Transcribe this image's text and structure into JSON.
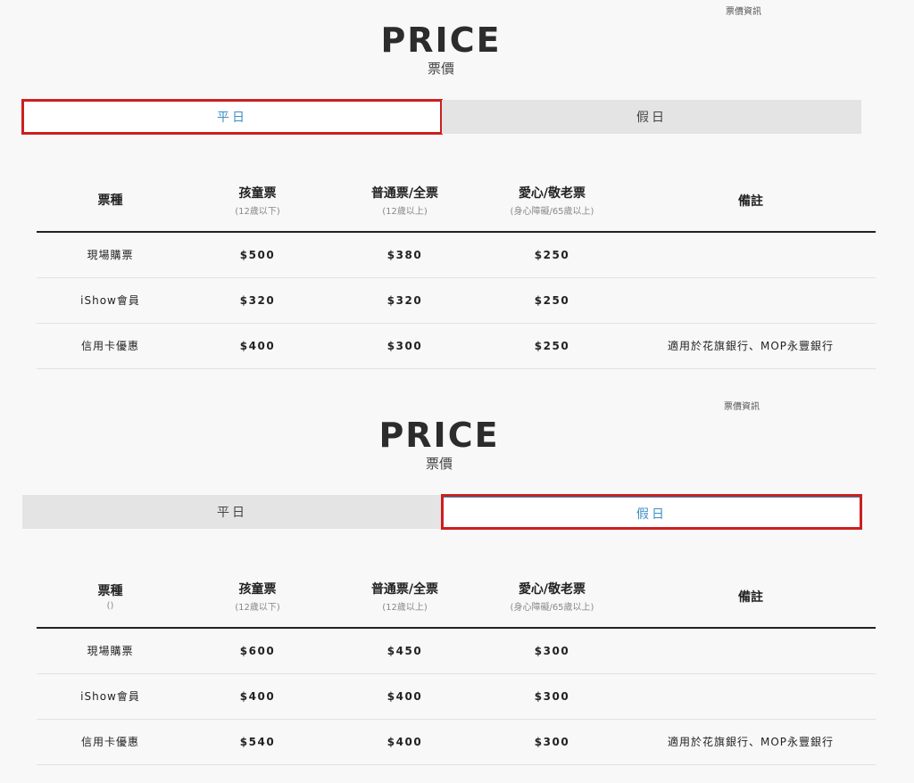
{
  "weekday": {
    "breadcrumb": "票價資訊",
    "title": "PRICE",
    "subtitle": "票價",
    "tabs": [
      {
        "label": "平日",
        "active": true
      },
      {
        "label": "假日",
        "active": false
      }
    ],
    "headers": [
      {
        "label": "票種",
        "note": ""
      },
      {
        "label": "孩童票",
        "note": "(12歲以下)"
      },
      {
        "label": "普通票/全票",
        "note": "(12歲以上)"
      },
      {
        "label": "愛心/敬老票",
        "note": "(身心障礙/65歲以上)"
      },
      {
        "label": "備註",
        "note": ""
      }
    ],
    "rows": [
      [
        "現場購票",
        "$500",
        "$380",
        "$250",
        ""
      ],
      [
        "iShow會員",
        "$320",
        "$320",
        "$250",
        ""
      ],
      [
        "信用卡優惠",
        "$400",
        "$300",
        "$250",
        "適用於花旗銀行、MOP永豐銀行"
      ]
    ]
  },
  "holiday": {
    "breadcrumb": "票價資訊",
    "title": "PRICE",
    "subtitle": "票價",
    "tabs": [
      {
        "label": "平日",
        "active": false
      },
      {
        "label": "假日",
        "active": true
      }
    ],
    "headers": [
      {
        "label": "票種",
        "note": "()"
      },
      {
        "label": "孩童票",
        "note": "(12歲以下)"
      },
      {
        "label": "普通票/全票",
        "note": "(12歲以上)"
      },
      {
        "label": "愛心/敬老票",
        "note": "(身心障礙/65歲以上)"
      },
      {
        "label": "備註",
        "note": ""
      }
    ],
    "rows": [
      [
        "現場購票",
        "$600",
        "$450",
        "$300",
        ""
      ],
      [
        "iShow會員",
        "$400",
        "$400",
        "$300",
        ""
      ],
      [
        "信用卡優惠",
        "$540",
        "$400",
        "$300",
        "適用於花旗銀行、MOP永豐銀行"
      ]
    ]
  },
  "colors": {
    "accent": "#3a8fc4",
    "highlight": "#cc1f1f",
    "tab_inactive": "#e4e4e4"
  }
}
